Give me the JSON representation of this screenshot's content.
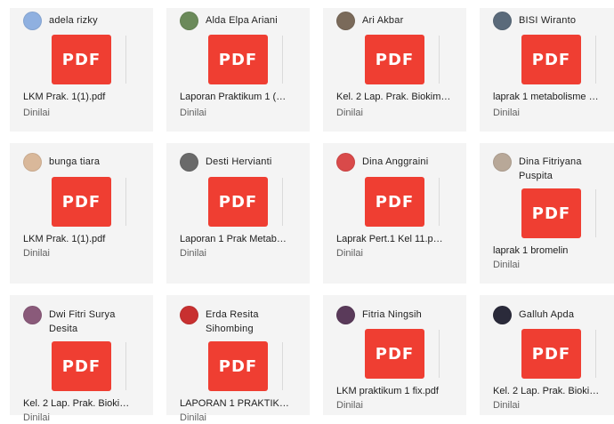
{
  "status_label": "Dinilai",
  "pdf_label": "PDF",
  "submissions": [
    {
      "student": "adela rizky",
      "file": "LKM Prak. 1(1).pdf",
      "avatar_color": "#8fb0e0"
    },
    {
      "student": "Alda Elpa Ariani",
      "file": "Laporan Praktikum 1 (…",
      "avatar_color": "#6b8a5a"
    },
    {
      "student": "Ari Akbar",
      "file": "Kel. 2 Lap. Prak. Biokim…",
      "avatar_color": "#7a6a5a"
    },
    {
      "student": "BISI Wiranto",
      "file": "laprak 1 metabolisme …",
      "avatar_color": "#5a6a7a"
    },
    {
      "student": "bunga tiara",
      "file": "LKM Prak. 1(1).pdf",
      "avatar_color": "#d9b89a"
    },
    {
      "student": "Desti Hervianti",
      "file": "Laporan 1 Prak Metab…",
      "avatar_color": "#6a6a6a"
    },
    {
      "student": "Dina Anggraini",
      "file": "Laprak Pert.1 Kel 11.p…",
      "avatar_color": "#d94a4a"
    },
    {
      "student": "Dina Fitriyana Puspita",
      "file": "laprak 1 bromelin",
      "avatar_color": "#b8a898"
    },
    {
      "student": "Dwi Fitri Surya Desita",
      "file": "Kel. 2 Lap. Prak. Bioki…",
      "avatar_color": "#8a5a7a"
    },
    {
      "student": "Erda Resita Sihombing",
      "file": "LAPORAN 1 PRAKTIK…",
      "avatar_color": "#c83030"
    },
    {
      "student": "Fitria Ningsih",
      "file": "LKM praktikum 1 fix.pdf",
      "avatar_color": "#5a3a5a"
    },
    {
      "student": "Galluh Apda",
      "file": "Kel. 2 Lap. Prak. Bioki…",
      "avatar_color": "#2a2a3a"
    }
  ]
}
